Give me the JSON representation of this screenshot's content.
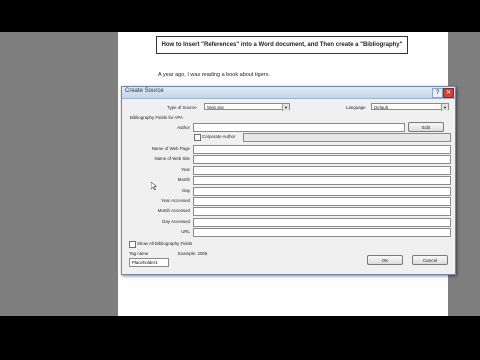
{
  "document": {
    "heading": "How to Insert \"References\" into a Word document, and Then create a \"Bibliography\"",
    "paragraph": "A year ago, I was reading a book about tigers."
  },
  "dialog": {
    "title": "Create Source",
    "type_of_source_label": "Type of Source",
    "type_of_source_value": "Web site",
    "language_label": "Language",
    "language_value": "Default",
    "fields_heading": "Bibliography Fields for APA",
    "author_label": "Author",
    "edit_button": "Edit",
    "corporate_author_label": "Corporate Author",
    "fields": [
      {
        "label": "Name of Web Page"
      },
      {
        "label": "Name of Web Site"
      },
      {
        "label": "Year"
      },
      {
        "label": "Month"
      },
      {
        "label": "Day"
      },
      {
        "label": "Year Accessed"
      },
      {
        "label": "Month Accessed"
      },
      {
        "label": "Day Accessed"
      },
      {
        "label": "URL"
      }
    ],
    "show_all_label": "Show All Bibliography Fields",
    "tag_name_label": "Tag name",
    "tag_name_value": "Placeholder1",
    "example_text": "Example: 2006",
    "ok_button": "OK",
    "cancel_button": "Cancel",
    "help_glyph": "?",
    "close_glyph": "✕"
  }
}
